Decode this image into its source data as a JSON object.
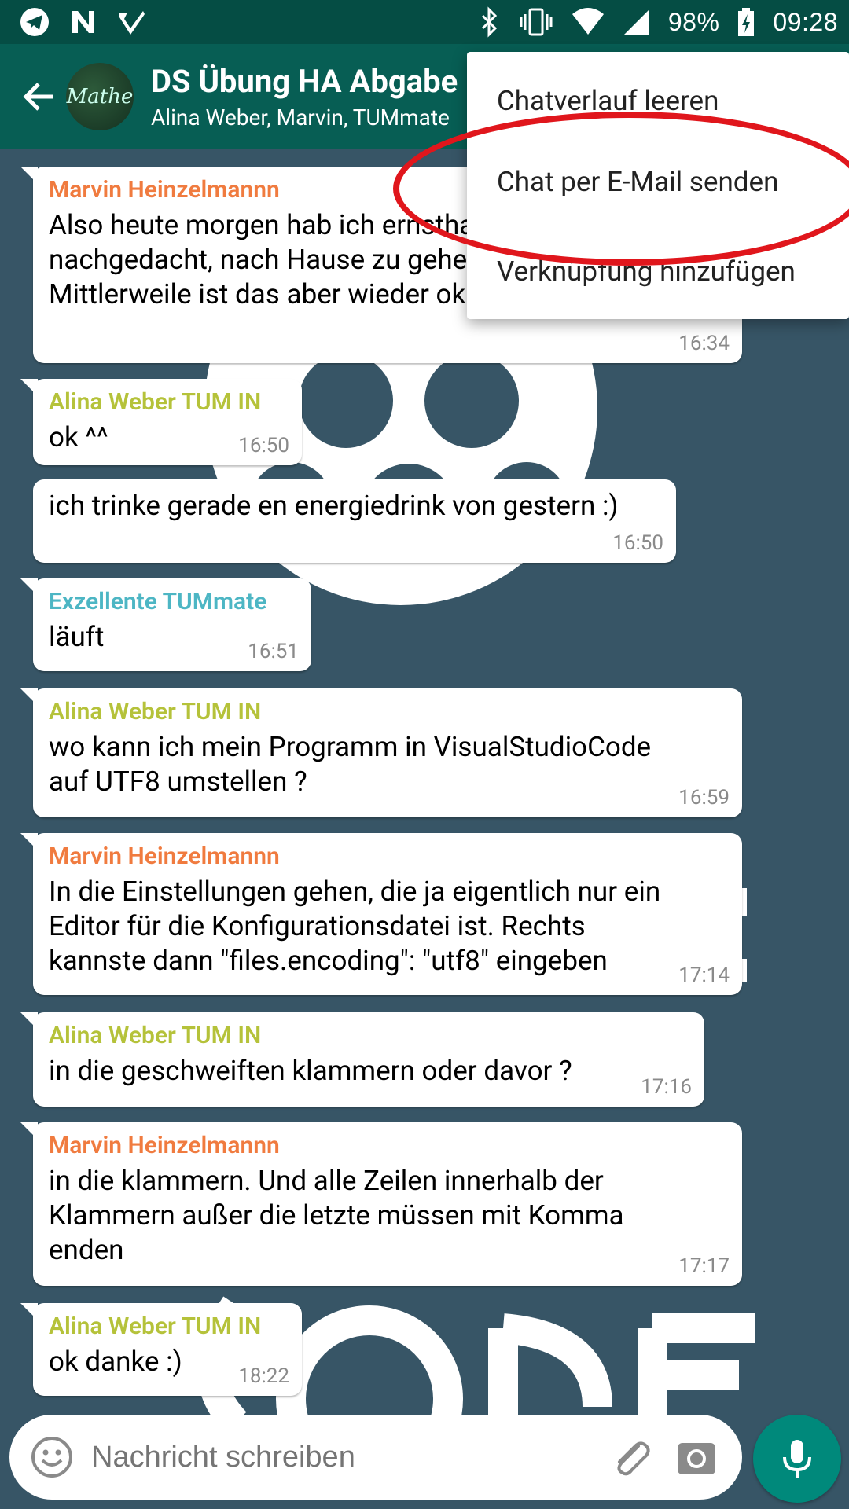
{
  "statusbar": {
    "battery": "98%",
    "time": "09:28"
  },
  "header": {
    "avatar_text": "Mathe",
    "title": "DS Übung HA Abgabe",
    "subtitle": "Alina Weber, Marvin, TUMmate"
  },
  "menu": {
    "items": [
      {
        "label": "Chatverlauf leeren"
      },
      {
        "label": "Chat per E-Mail senden"
      },
      {
        "label": "Verknüpfung hinzufügen"
      }
    ]
  },
  "messages": [
    {
      "sender": "Marvin Heinzelmannn",
      "text": "Also heute morgen hab ich ernsthaft darüber nachgedacht, nach Hause zu gehen, so müde war ich. Mittlerweile ist das aber wieder okay",
      "time": "16:34"
    },
    {
      "sender": "Alina Weber TUM IN",
      "text": "ok ^^",
      "time": "16:50"
    },
    {
      "sender": "",
      "text": "ich trinke gerade en energiedrink von gestern :)",
      "time": "16:50"
    },
    {
      "sender": "Exzellente TUMmate",
      "text": "läuft",
      "time": "16:51"
    },
    {
      "sender": "Alina Weber TUM IN",
      "text": "wo kann ich mein Programm in VisualStudioCode auf UTF8 umstellen ?",
      "time": "16:59"
    },
    {
      "sender": "Marvin Heinzelmannn",
      "text": "In die Einstellungen gehen, die ja eigentlich nur ein Editor für die Konfigurationsdatei ist. Rechts kannste dann \"files.encoding\": \"utf8\" eingeben",
      "time": "17:14"
    },
    {
      "sender": "Alina Weber TUM IN",
      "text": "in die geschweiften klammern oder davor ?",
      "time": "17:16"
    },
    {
      "sender": "Marvin Heinzelmannn",
      "text": "in die klammern. Und alle Zeilen innerhalb der Klammern außer die letzte müssen mit Komma enden",
      "time": "17:17"
    },
    {
      "sender": "Alina Weber TUM IN",
      "text": "ok danke :)",
      "time": "18:22"
    }
  ],
  "composer": {
    "placeholder": "Nachricht schreiben"
  },
  "colors": {
    "appbar": "#075e54",
    "statusbar": "#054d44",
    "chat_bg": "#375566",
    "marvin": "#f07b3f",
    "alina": "#b5c23a",
    "tummate": "#4db6c4",
    "highlight": "#e0161c",
    "mic": "#00897b"
  }
}
